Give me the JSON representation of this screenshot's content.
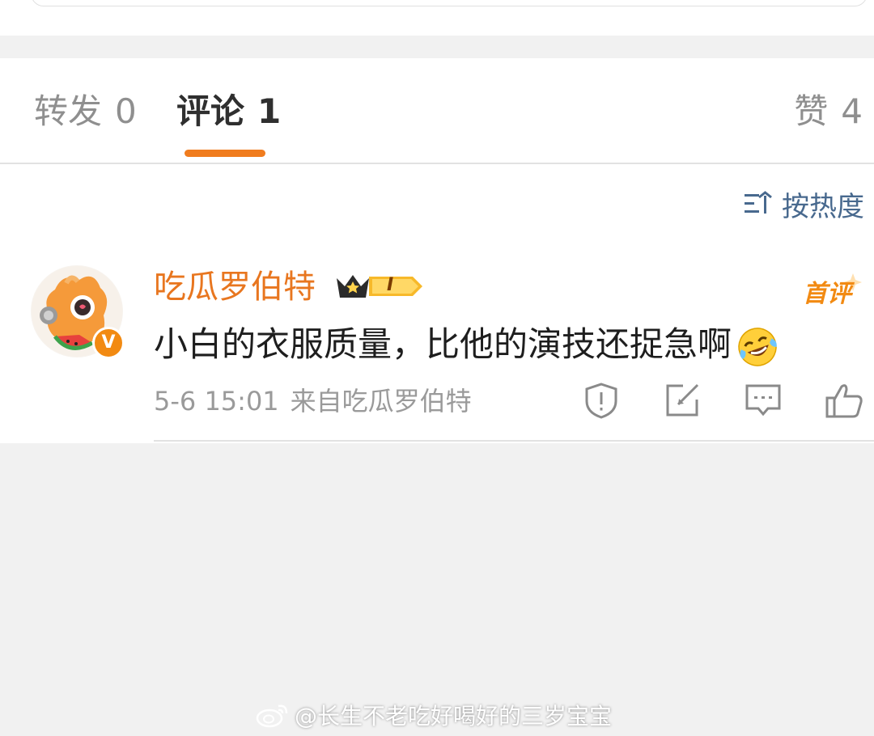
{
  "tabs": {
    "reposts": {
      "label": "转发",
      "count": "0"
    },
    "comments": {
      "label": "评论",
      "count": "1"
    },
    "likes": {
      "label": "赞",
      "count": "4"
    }
  },
  "sort": {
    "label": "按热度"
  },
  "comment": {
    "username": "吃瓜罗伯特",
    "badge_text": "首评",
    "member_level": "I",
    "vip_mark": "V",
    "text": "小白的衣服质量，比他的演技还捉急啊",
    "time": "5-6 15:01",
    "source": "来自吃瓜罗伯特",
    "icons": [
      "report-icon",
      "repost-icon",
      "reply-icon",
      "like-icon"
    ]
  },
  "watermark": {
    "text": "@长生不老吃好喝好的三岁宝宝"
  },
  "colors": {
    "accent": "#f07c1e",
    "username": "#e8761f",
    "sort": "#48698e",
    "background": "#f1f1f1"
  }
}
